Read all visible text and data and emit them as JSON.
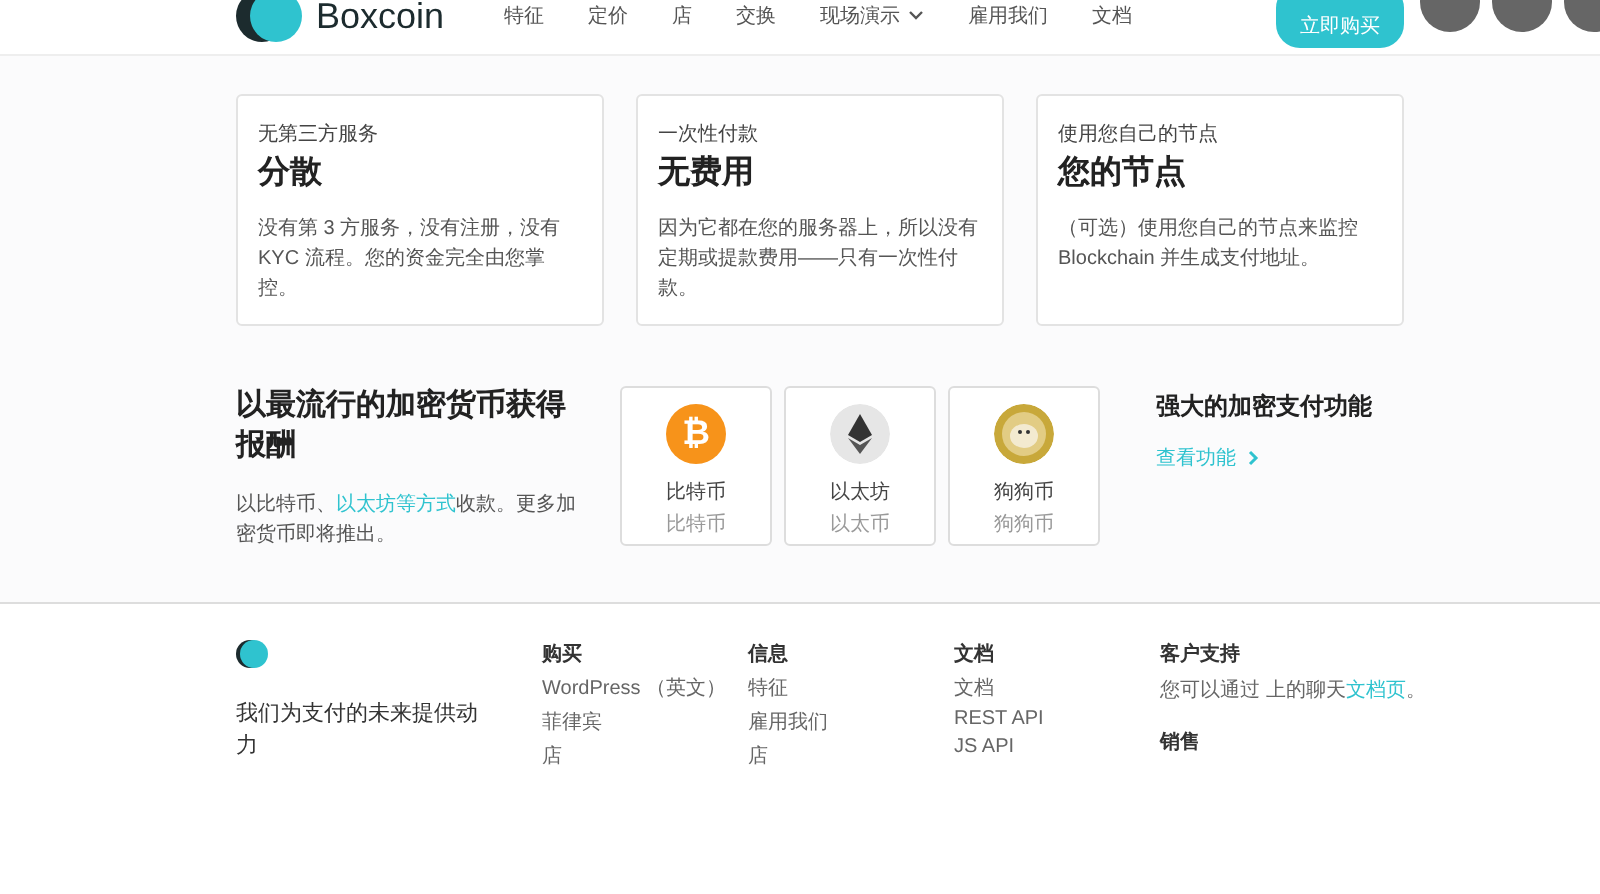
{
  "nav": {
    "logo": "Boxcoin",
    "links": [
      {
        "label": "特征",
        "dropdown": false
      },
      {
        "label": "定价",
        "dropdown": false
      },
      {
        "label": "店",
        "dropdown": false
      },
      {
        "label": "交换",
        "dropdown": false
      },
      {
        "label": "现场演示",
        "dropdown": true
      },
      {
        "label": "雇用我们",
        "dropdown": false
      },
      {
        "label": "文档",
        "dropdown": false
      }
    ],
    "button": "立即购买"
  },
  "features": [
    {
      "eyebrow": "无第三方服务",
      "title": "分散",
      "text": "没有第 3 方服务，没有注册，没有 KYC 流程。您的资金完全由您掌控。"
    },
    {
      "eyebrow": "一次性付款",
      "title": "无费用",
      "text": "因为它都在您的服务器上，所以没有定期或提款费用——只有一次性付款。"
    },
    {
      "eyebrow": "使用您自己的节点",
      "title": "您的节点",
      "text": "（可选）使用您自己的节点来监控 Blockchain 并生成支付地址。"
    }
  ],
  "crypto": {
    "title": "以最流行的加密货币获得报酬",
    "text_before": "以比特币、",
    "text_link": "以太坊等方式",
    "text_after": "收款。更多加密货币即将推出。"
  },
  "coins": [
    {
      "kind": "bitcoin",
      "symbol": "₿",
      "name": "比特币",
      "sub": "比特币"
    },
    {
      "kind": "ethereum",
      "name": "以太坊",
      "sub": "以太币"
    },
    {
      "kind": "dogecoin",
      "name": "狗狗币",
      "sub": "狗狗币"
    }
  ],
  "side": {
    "title": "强大的加密支付功能",
    "link": "查看功能"
  },
  "footer": {
    "tagline": "我们为支付的未来提供动力",
    "columns": [
      {
        "heading": "购买",
        "items": [
          "WordPress （英文）",
          "菲律宾",
          "店"
        ]
      },
      {
        "heading": "信息",
        "items": [
          "特征",
          "雇用我们",
          "店"
        ]
      },
      {
        "heading": "文档",
        "items": [
          "文档",
          "REST API",
          "JS API"
        ]
      }
    ],
    "support": {
      "heading": "客户支持",
      "text_before": "您可以通过 上的聊天",
      "text_link": "文档页",
      "text_after": "。",
      "heading2": "销售"
    }
  }
}
